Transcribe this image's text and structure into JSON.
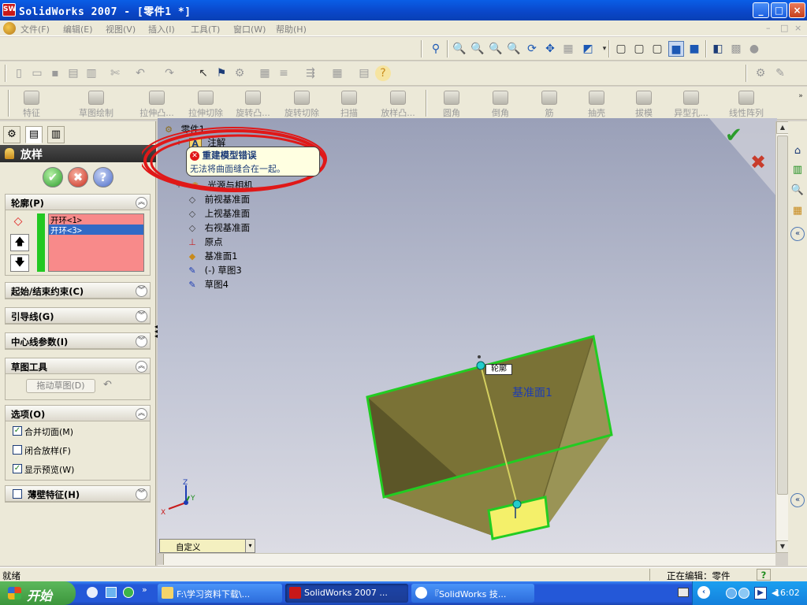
{
  "window": {
    "app_icon": "SW",
    "title": "SolidWorks 2007 - [零件1 *]",
    "min_label": "_",
    "max_label": "□",
    "close_label": "×"
  },
  "menu": {
    "items": [
      "文件(F)",
      "编辑(E)",
      "视图(V)",
      "插入(I)",
      "工具(T)",
      "窗口(W)",
      "帮助(H)"
    ],
    "mdi": {
      "min": "–",
      "restore": "□",
      "close": "×"
    }
  },
  "features": [
    "拉伸凸...",
    "拉伸切除",
    "旋转凸...",
    "旋转切除",
    "扫描",
    "放样凸...",
    "圆角",
    "倒角",
    "筋",
    "抽壳",
    "拔模",
    "异型孔...",
    "线性阵列"
  ],
  "sketch_tools": {
    "feature_label": "特征",
    "sketch_label": "草图绘制"
  },
  "property_manager": {
    "title": "放样",
    "ok_icon": "✔",
    "cancel_icon": "✖",
    "help_icon": "?",
    "profiles": {
      "header": "轮廓(P)",
      "items": [
        "开环<1>",
        "开环<3>"
      ],
      "selected_index": 1,
      "up_icon": "🡅",
      "down_icon": "🡇"
    },
    "start_end": {
      "header": "起始/结束约束(C)"
    },
    "guides": {
      "header": "引导线(G)"
    },
    "centerline": {
      "header": "中心线参数(I)"
    },
    "sketch_tools": {
      "header": "草图工具",
      "drag_button": "拖动草图(D)"
    },
    "options": {
      "header": "选项(O)",
      "items": [
        {
          "label": "合并切面(M)",
          "checked": true
        },
        {
          "label": "闭合放样(F)",
          "checked": false
        },
        {
          "label": "显示预览(W)",
          "checked": true
        }
      ]
    },
    "thin": {
      "header": "薄壁特征(H)",
      "checked": false
    }
  },
  "tree": {
    "root": "零件1",
    "items": [
      {
        "label": "注解",
        "icon": "annotation-icon"
      },
      {
        "label": "光源与相机",
        "icon": "lights-icon"
      },
      {
        "label": "前视基准面",
        "icon": "plane-icon"
      },
      {
        "label": "上视基准面",
        "icon": "plane-icon"
      },
      {
        "label": "右视基准面",
        "icon": "plane-icon"
      },
      {
        "label": "原点",
        "icon": "origin-icon"
      },
      {
        "label": "基准面1",
        "icon": "plane-icon"
      },
      {
        "label": "(-) 草图3",
        "icon": "sketch-icon"
      },
      {
        "label": "草图4",
        "icon": "sketch-icon"
      }
    ]
  },
  "error": {
    "title": "重建模型错误",
    "message": "无法将曲面缝合在一起。"
  },
  "viewport": {
    "plane_label": "基准面1",
    "profile_callout": "轮廓",
    "view_dropdown": "自定义",
    "triad": {
      "x": "X",
      "y": "Y",
      "z": "Z"
    }
  },
  "status": {
    "left": "就绪",
    "editing": "正在编辑：零件",
    "help": "?"
  },
  "taskbar": {
    "start": "开始",
    "tasks": [
      "F:\\学习资料下载\\...",
      "SolidWorks 2007 ...",
      "『SolidWorks 技..."
    ],
    "time": "16:02"
  },
  "colors": {
    "accent": "#0a5ee6",
    "model_face": "#7a7236",
    "edge_highlight": "#22cc22",
    "profile_fill": "#f4f06a",
    "error_red": "#e01818"
  }
}
